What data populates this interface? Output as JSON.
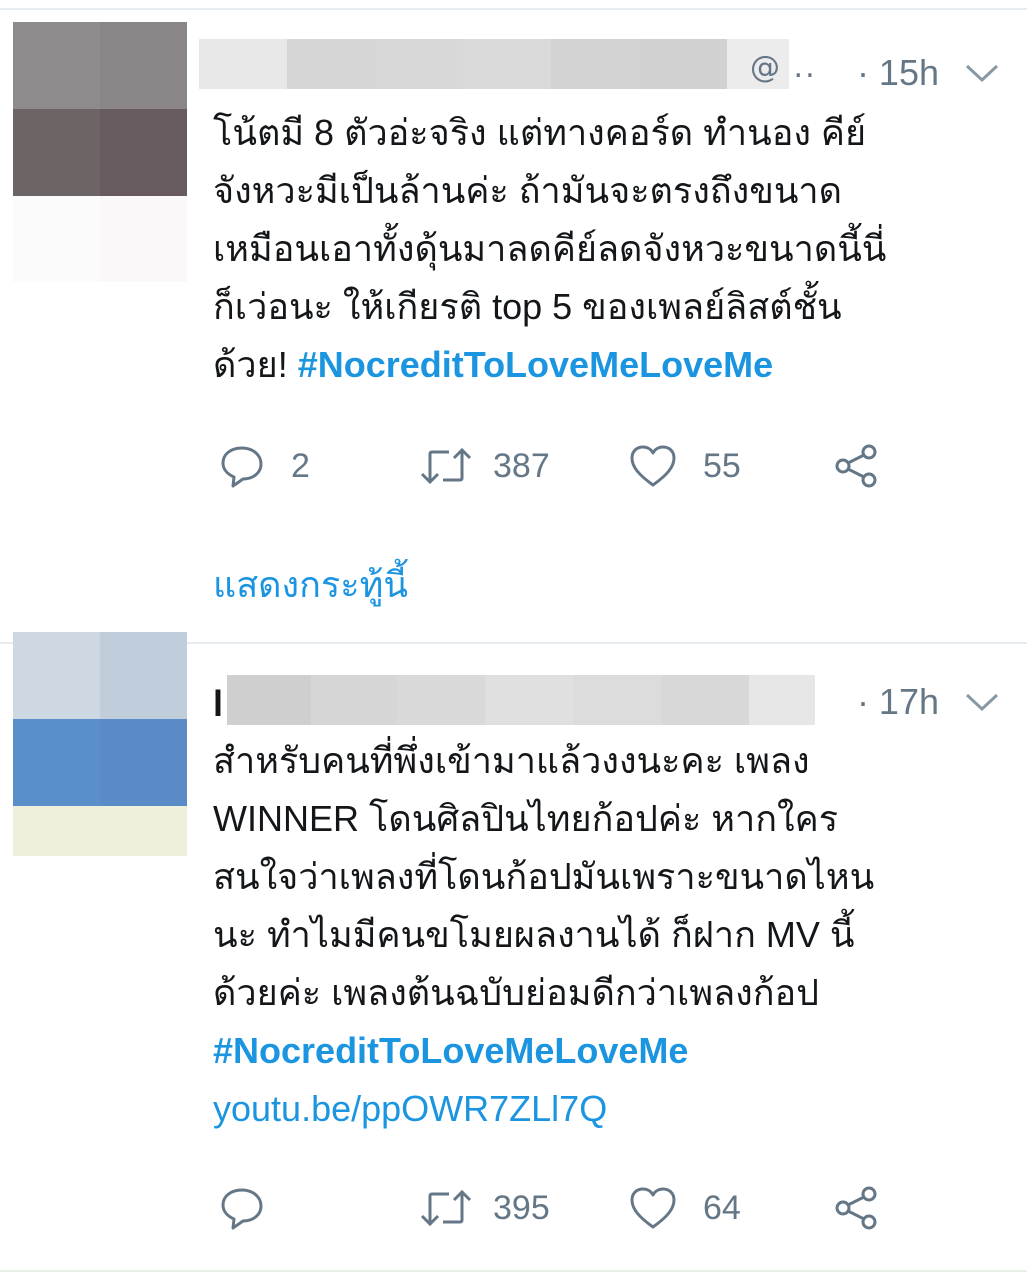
{
  "tweets": [
    {
      "author_initial": "",
      "handle_tail": "@ ..",
      "time": "· 15h",
      "text_lines": [
        "โน้ตมี 8 ตัวอ่ะจริง แต่ทางคอร์ด ทำนอง คีย์",
        "จังหวะมีเป็นล้านค่ะ ถ้ามันจะตรงถึงขนาด",
        "เหมือนเอาทั้งดุ้นมาลดคีย์ลดจังหวะขนาดนี้นี่",
        "ก็เว่อนะ ให้เกียรติ top 5 ของเพลย์ลิสต์ชั้น"
      ],
      "last_line_prefix": "ด้วย! ",
      "hashtag": "#NocreditToLoveMeLoveMe",
      "replies": "2",
      "retweets": "387",
      "likes": "55",
      "show_thread": "แสดงกระทู้นี้"
    },
    {
      "author_initial": "l",
      "time": "· 17h",
      "text_lines": [
        "สำหรับคนที่พึ่งเข้ามาแล้วงงนะคะ เพลง",
        "WINNER โดนศิลปินไทยก้อปค่ะ หากใคร",
        "สนใจว่าเพลงที่โดนก้อปมันเพราะขนาดไหน",
        "นะ ทำไมมีคนขโมยผลงานได้ ก็ฝาก MV นี้",
        "ด้วยค่ะ เพลงต้นฉบับย่อมดีกว่าเพลงก้อป"
      ],
      "hashtag": "#NocreditToLoveMeLoveMe",
      "link": "youtu.be/ppOWR7ZLl7Q",
      "replies": "",
      "retweets": "395",
      "likes": "64"
    }
  ],
  "colors": {
    "accent": "#1b95e0",
    "secondary_text": "#657786",
    "divider": "#e6ecf0"
  },
  "icons": [
    "reply-icon",
    "retweet-icon",
    "like-icon",
    "share-icon",
    "chevron-down-icon"
  ]
}
